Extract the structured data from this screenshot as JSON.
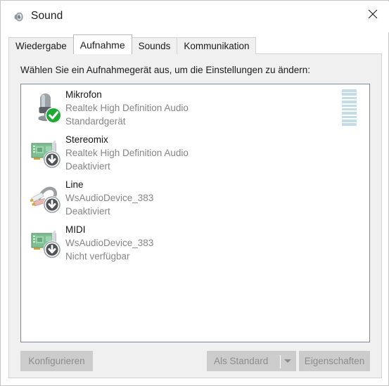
{
  "window": {
    "title": "Sound",
    "title_icon": "speaker-icon",
    "close_icon": "close-icon"
  },
  "tabs": [
    {
      "label": "Wiedergabe",
      "active": false
    },
    {
      "label": "Aufnahme",
      "active": true
    },
    {
      "label": "Sounds",
      "active": false
    },
    {
      "label": "Kommunikation",
      "active": false
    }
  ],
  "instruction": "Wählen Sie ein Aufnahmegerät aus, um die Einstellungen zu ändern:",
  "devices": [
    {
      "name": "Mikrofon",
      "driver": "Realtek High Definition Audio",
      "status": "Standardgerät",
      "icon": "microphone-icon",
      "badge": "green-check-badge",
      "meter_segments": 10,
      "meter_color": "#c3dce5"
    },
    {
      "name": "Stereomix",
      "driver": "Realtek High Definition Audio",
      "status": "Deaktiviert",
      "icon": "sound-card-icon",
      "badge": "gray-down-arrow-badge",
      "meter_segments": 0
    },
    {
      "name": "Line",
      "driver": "WsAudioDevice_383",
      "status": "Deaktiviert",
      "icon": "rca-cable-icon",
      "badge": "gray-down-arrow-badge",
      "meter_segments": 0
    },
    {
      "name": "MIDI",
      "driver": "WsAudioDevice_383",
      "status": "Nicht verfügbar",
      "icon": "sound-card-icon",
      "badge": "gray-down-arrow-badge",
      "meter_segments": 0
    }
  ],
  "buttons": {
    "configure": "Konfigurieren",
    "set_default": "Als Standard",
    "set_default_arrow_icon": "chevron-down-icon",
    "properties": "Eigenschaften"
  },
  "colors": {
    "accent_green": "#1faa38",
    "meter_blue": "#c3dce5",
    "list_border": "#7c8999",
    "panel_bg": "#f0f0f0",
    "disabled_text": "#8d8d8d"
  }
}
